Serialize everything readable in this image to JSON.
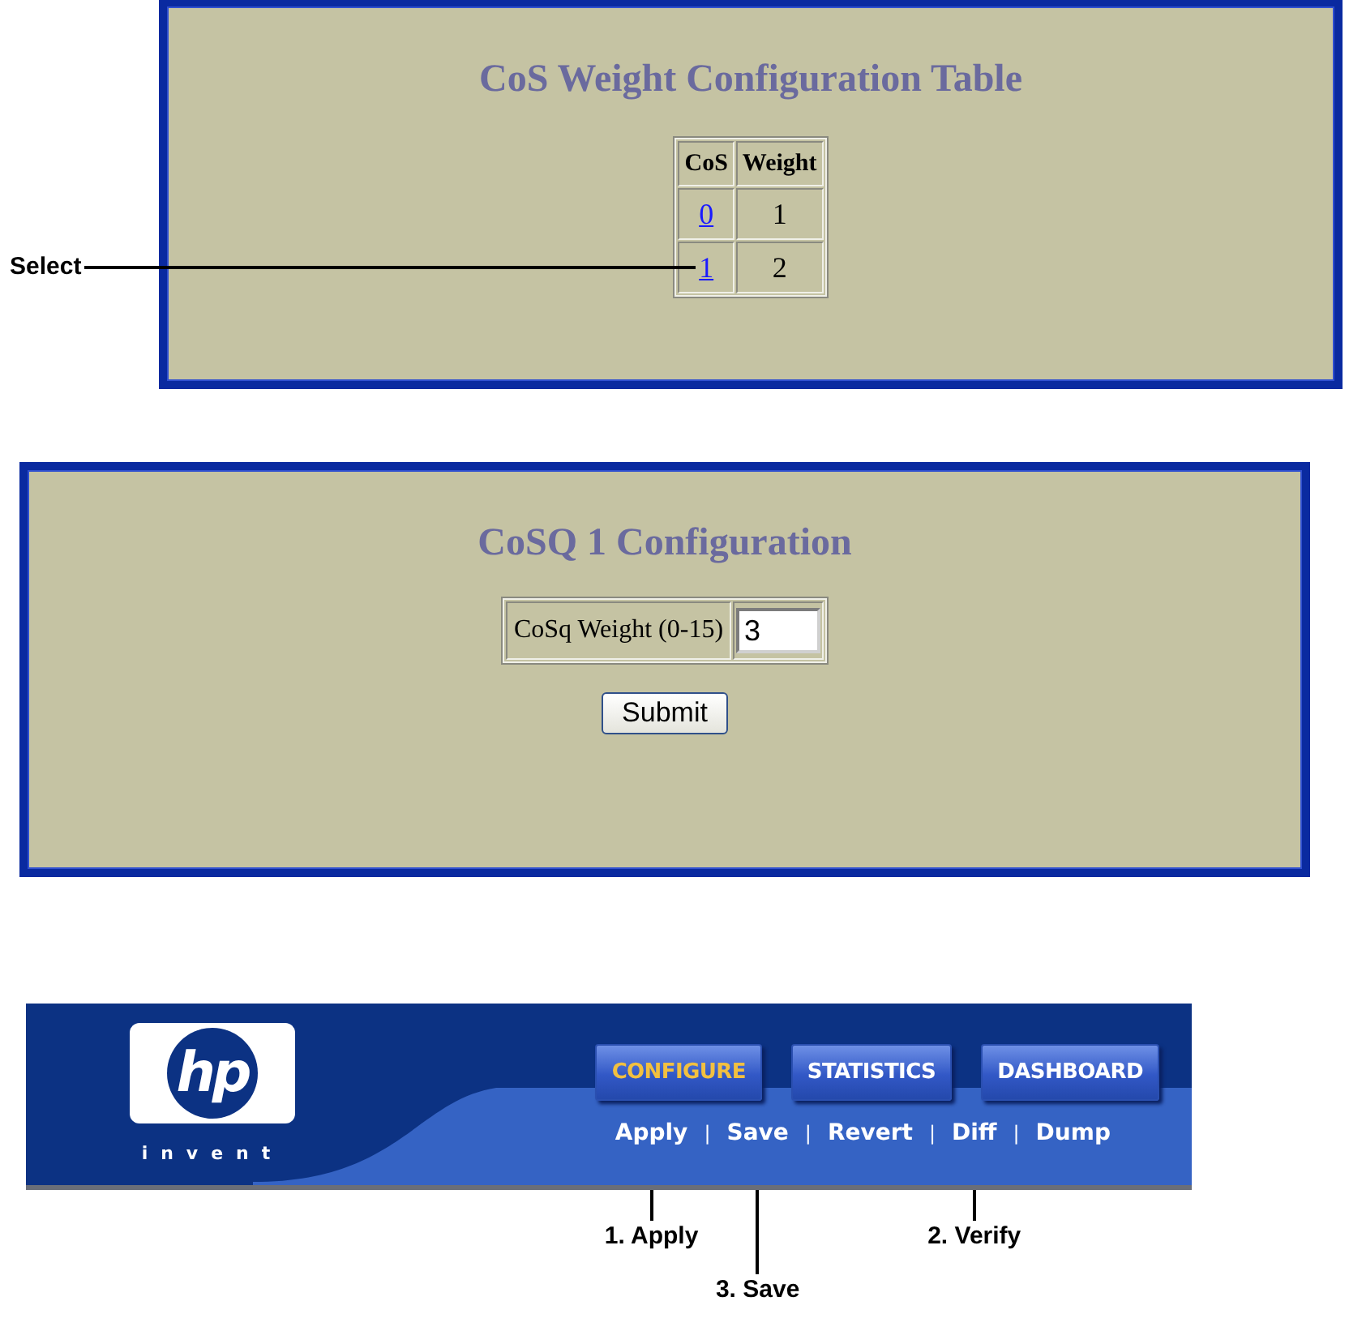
{
  "cos_table_panel": {
    "title": "CoS Weight Configuration Table",
    "columns": [
      "CoS",
      "Weight"
    ],
    "rows": [
      {
        "cos": "0",
        "weight": "1"
      },
      {
        "cos": "1",
        "weight": "2",
        "callout": "Select"
      }
    ]
  },
  "cosq_panel": {
    "title": "CoSQ 1 Configuration",
    "field_label": "CoSq Weight (0-15)",
    "field_value": "3",
    "button": "Submit"
  },
  "banner": {
    "logo": {
      "text": "hp",
      "tagline": "invent"
    },
    "tabs": [
      {
        "label": "CONFIGURE",
        "selected": true
      },
      {
        "label": "STATISTICS",
        "selected": false
      },
      {
        "label": "DASHBOARD",
        "selected": false
      }
    ],
    "actions": [
      {
        "label": "Apply",
        "callout": "1. Apply"
      },
      {
        "label": "Save",
        "callout": "3. Save"
      },
      {
        "label": "Revert"
      },
      {
        "label": "Diff",
        "callout": "2. Verify"
      },
      {
        "label": "Dump"
      }
    ],
    "separator": "|"
  }
}
